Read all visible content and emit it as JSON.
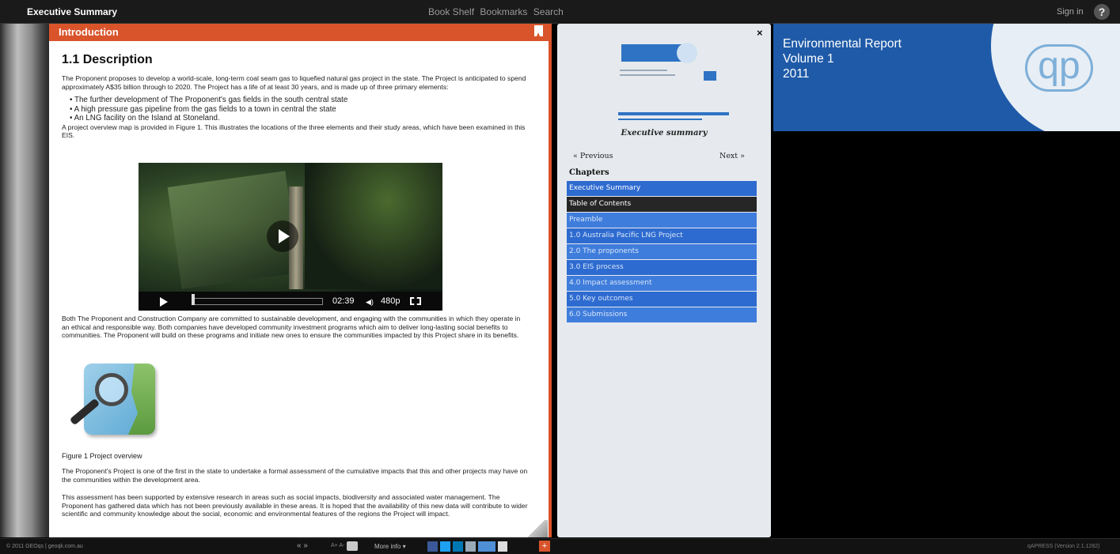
{
  "topbar": {
    "title": "Executive Summary",
    "nav": [
      "Book Shelf",
      "Bookmarks",
      "Search"
    ],
    "sign_in": "Sign in",
    "help": "?"
  },
  "page": {
    "section_title": "Introduction",
    "heading": "1.1 Description",
    "p1": "The Proponent proposes to develop a world-scale, long-term coal seam gas to liquefied natural gas project in the state. The Project is anticipated to spend approximately A$35 billion through to 2020. The Project has a life of at least 30 years, and is made up of three primary elements:",
    "bullets": [
      "The further development of The Proponent's gas fields in the south central state",
      "A high pressure gas pipeline from the gas fields to a town in central the state",
      "An LNG facility on the Island at Stoneland."
    ],
    "p_map": "A project overview map is provided in Figure 1. This illustrates the locations of the three elements and their study areas, which have been examined in this EIS.",
    "video": {
      "time": "02:39",
      "quality": "480p"
    },
    "p2": "Both The Proponent and Construction Company are committed to sustainable development, and engaging with the communities in which they operate in an ethical and responsible way. Both companies have developed community investment programs which aim to deliver long-lasting social benefits to communities. The Proponent will build on these programs and initiate new ones to ensure the communities impacted by this Project share in its benefits.",
    "figure_caption": "Figure 1 Project overview",
    "p3": "The Proponent's Project is one of the first in the state to undertake a formal assessment of the cumulative impacts that this and other projects may have on the communities within the development area.",
    "p4": "This assessment has been supported by extensive research in areas such as social impacts, biodiversity and associated water management. The Proponent has gathered data which has not been previously available in these areas. It is hoped that the availability of this new data will contribute to wider scientific and community knowledge about the social, economic and environmental features of the regions the Project will impact."
  },
  "toc": {
    "close": "×",
    "summary_title": "Executive summary",
    "prev": "« Previous",
    "next": "Next »",
    "chapters_heading": "Chapters",
    "chapters": [
      "Executive Summary",
      "Table of Contents",
      "Preamble",
      "1.0 Australia Pacific LNG Project",
      "2.0 The proponents",
      "3.0 EIS process",
      "4.0 Impact assessment",
      "5.0 Key outcomes",
      "6.0 Submissions"
    ]
  },
  "cover": {
    "title_line1": "Environmental Report",
    "title_line2": "Volume 1",
    "year": "2011",
    "logo": "qp"
  },
  "bottombar": {
    "copyright": "© 2011 GEOqs | geoqk.com.au",
    "nav": "« »",
    "font_size": "A+ A-",
    "more_info": "More info ▾",
    "version": "qAPRESS (Version 2.1.1282)"
  },
  "colors": {
    "accent": "#d9542b",
    "toc_blue": "#2e6bd0",
    "cover_blue": "#1f5aa8"
  }
}
